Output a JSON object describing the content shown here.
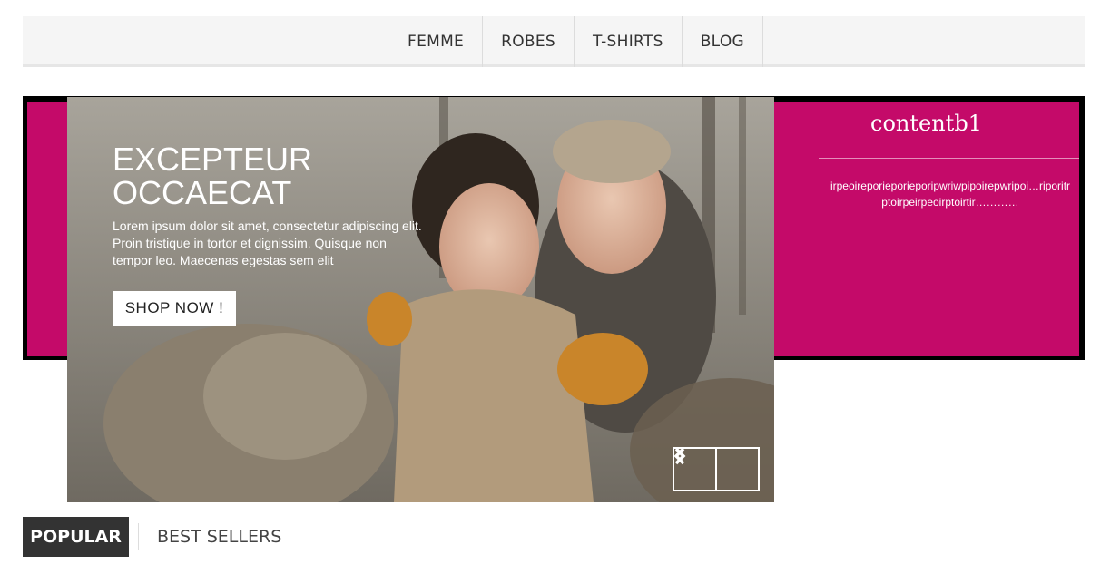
{
  "nav": {
    "items": [
      {
        "label": "FEMME"
      },
      {
        "label": "ROBES"
      },
      {
        "label": "T-SHIRTS"
      },
      {
        "label": "BLOG"
      }
    ]
  },
  "slide": {
    "heading": "EXCEPTEUR OCCAECAT",
    "text": "Lorem ipsum dolor sit amet, consectetur adipiscing elit. Proin tristique in tortor et dignissim. Quisque non tempor leo. Maecenas egestas sem elit",
    "cta": "SHOP NOW !",
    "prev_icon": "chevron-left-icon",
    "next_icon": "chevron-right-icon"
  },
  "side_panel": {
    "title": "contentb1",
    "text": "irpeoireporieporieporipwriwpipoirepwripoi…riporitrptoirpeirpeoirptoirtir…………"
  },
  "tabs": {
    "popular": "POPULAR",
    "best_sellers": "BEST SELLERS"
  },
  "colors": {
    "accent_pink": "#c40a69",
    "nav_bg": "#f5f5f5",
    "tab_active_bg": "#333333"
  }
}
